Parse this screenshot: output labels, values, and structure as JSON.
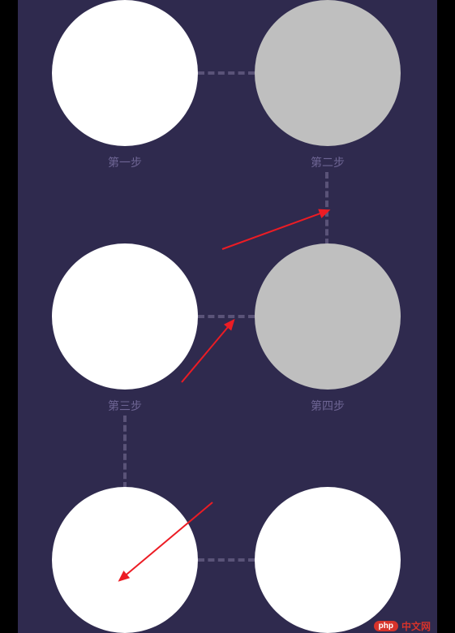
{
  "steps": {
    "step1": {
      "label": "第一步",
      "color": "white"
    },
    "step2": {
      "label": "第二步",
      "color": "gray"
    },
    "step3": {
      "label": "第三步",
      "color": "white"
    },
    "step4": {
      "label": "第四步",
      "color": "gray"
    },
    "step5": {
      "label": "",
      "color": "white"
    },
    "step6": {
      "label": "",
      "color": "white"
    }
  },
  "watermark": {
    "badge": "php",
    "text": "中文网"
  },
  "colors": {
    "background": "#2f2a4e",
    "label": "#6e6594",
    "connector": "#5a5378",
    "arrow": "#ec1c24"
  }
}
